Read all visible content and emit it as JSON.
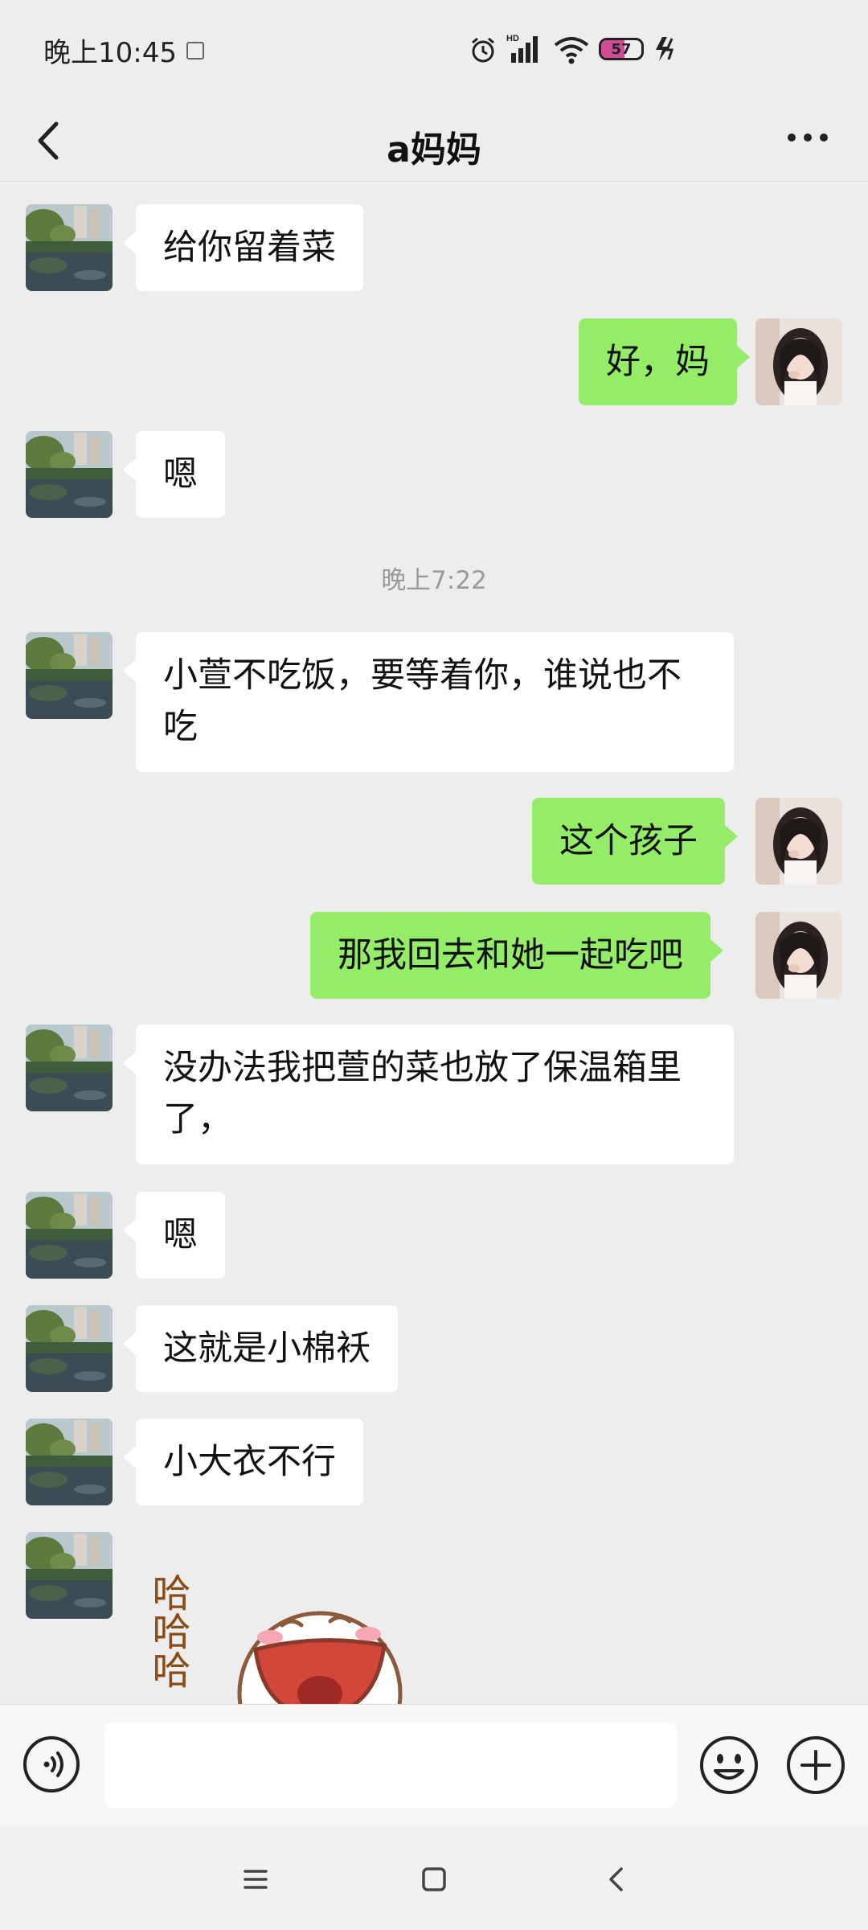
{
  "status_bar": {
    "time": "晚上10:45",
    "battery": {
      "level": "57",
      "fill_percent": 57
    },
    "icons": [
      "alarm-icon",
      "hd-signal-icon",
      "wifi-icon",
      "battery-icon",
      "charging-icon"
    ]
  },
  "header": {
    "title": "a妈妈",
    "back_icon": "chevron-left-icon",
    "more_icon": "more-icon"
  },
  "chat": {
    "timestamp": "晚上7:22",
    "messages": [
      {
        "side": "left",
        "text": "给你留着菜"
      },
      {
        "side": "right",
        "text": "好，妈"
      },
      {
        "side": "left",
        "text": "嗯"
      },
      {
        "side": "left",
        "text": "小萱不吃饭，要等着你，谁说也不吃"
      },
      {
        "side": "right",
        "text": "这个孩子"
      },
      {
        "side": "right",
        "text": "那我回去和她一起吃吧"
      },
      {
        "side": "left",
        "text": "没办法我把萱的菜也放了保温箱里了，"
      },
      {
        "side": "left",
        "text": "嗯"
      },
      {
        "side": "left",
        "text": "这就是小棉袄"
      },
      {
        "side": "left",
        "text": "小大衣不行"
      },
      {
        "side": "left",
        "sticker": "laughing-sticker",
        "text": "哈哈哈"
      }
    ]
  },
  "input_bar": {
    "value": "",
    "icons": [
      "voice-icon",
      "emoji-icon",
      "plus-icon"
    ]
  },
  "nav_bar": {
    "icons": [
      "menu-icon",
      "home-icon",
      "back-icon"
    ]
  },
  "colors": {
    "background": "#ededed",
    "bubble_self": "#95ec69",
    "bubble_other": "#ffffff",
    "battery_accent": "#d04d94"
  }
}
